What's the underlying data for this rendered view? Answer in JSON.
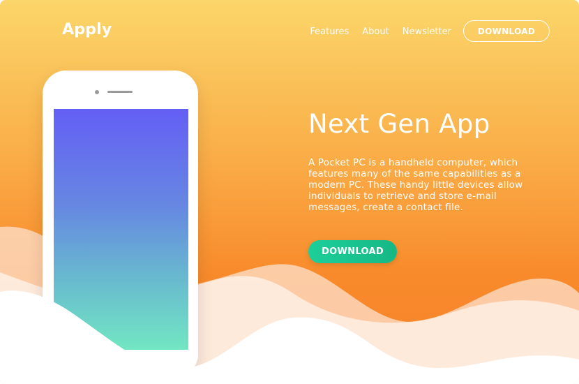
{
  "header": {
    "logo": "Apply",
    "nav": [
      {
        "label": "Features"
      },
      {
        "label": "About"
      },
      {
        "label": "Newsletter"
      }
    ],
    "download_button": "DOWNLOAD"
  },
  "hero": {
    "title": "Next Gen App",
    "description": "A Pocket PC is a handheld computer, which features many of the same capabilities as a modern PC. These handy little devices allow individuals to retrieve and store e-mail messages, create a contact file.",
    "cta_label": "DOWNLOAD"
  },
  "colors": {
    "gradient_top": "#fbd66a",
    "gradient_bottom": "#f6822a",
    "cta_green": "#1ccf9a",
    "screen_top": "#645ff5",
    "screen_bottom": "#72e6c2"
  }
}
